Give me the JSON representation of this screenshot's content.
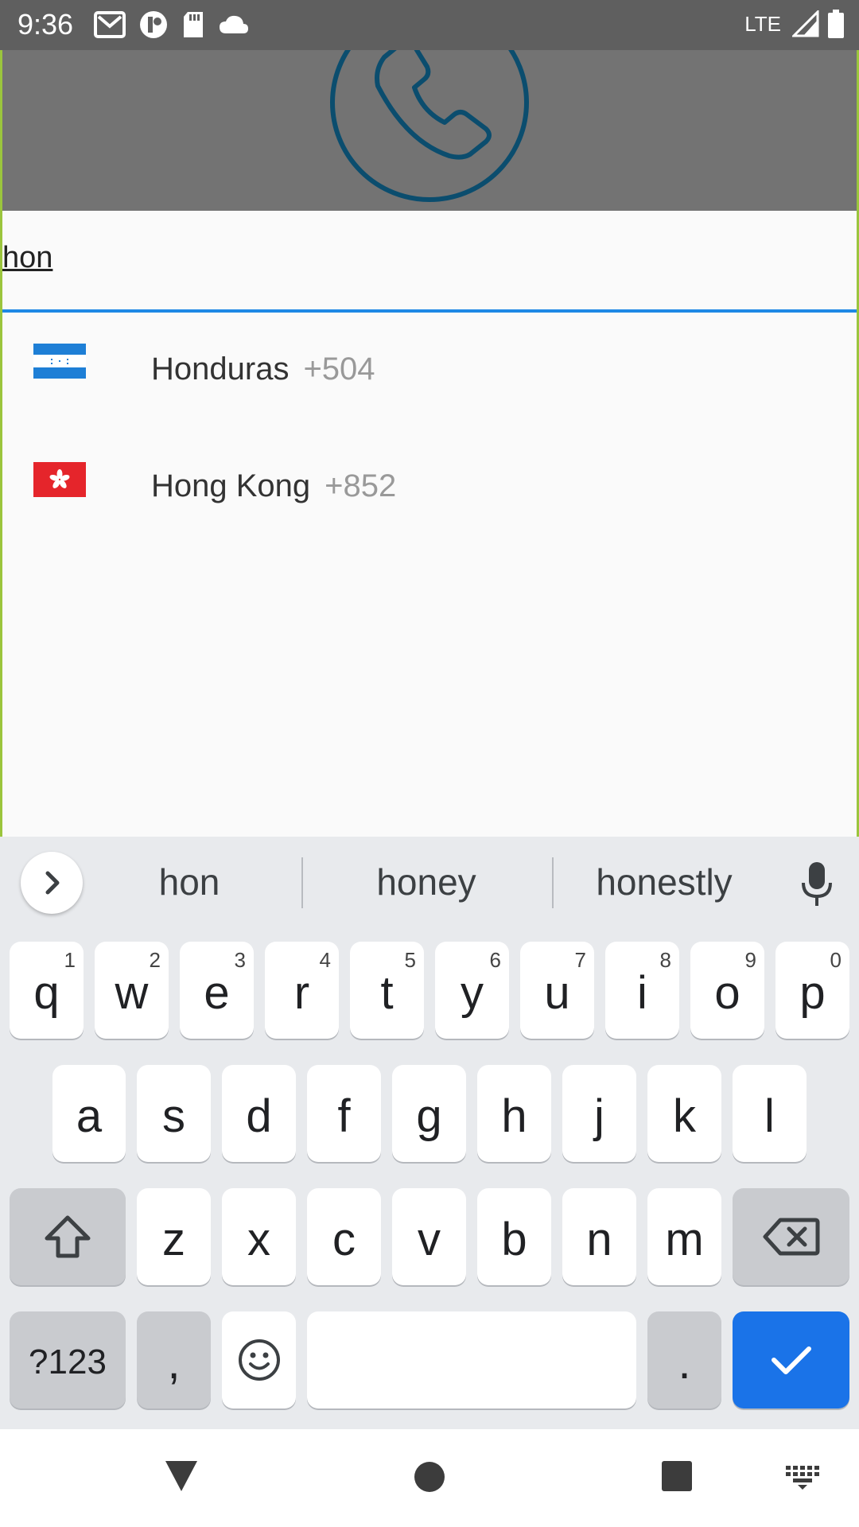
{
  "status_bar": {
    "time": "9:36",
    "network": "LTE",
    "icons_left": [
      "gmail-icon",
      "app-icon",
      "sd-card-icon",
      "cloud-icon"
    ],
    "icons_right": [
      "signal-icon",
      "battery-icon"
    ]
  },
  "header": {
    "logo": "phone-icon",
    "logo_color": "#0b4d6e"
  },
  "search": {
    "value": "hon",
    "underline_color": "#1e88e5"
  },
  "countries": [
    {
      "name": "Honduras",
      "code": "+504",
      "flag": "honduras-flag"
    },
    {
      "name": "Hong Kong",
      "code": "+852",
      "flag": "hong-kong-flag"
    }
  ],
  "keyboard": {
    "suggestions": [
      "hon",
      "honey",
      "honestly"
    ],
    "row1": [
      {
        "key": "q",
        "hint": "1"
      },
      {
        "key": "w",
        "hint": "2"
      },
      {
        "key": "e",
        "hint": "3"
      },
      {
        "key": "r",
        "hint": "4"
      },
      {
        "key": "t",
        "hint": "5"
      },
      {
        "key": "y",
        "hint": "6"
      },
      {
        "key": "u",
        "hint": "7"
      },
      {
        "key": "i",
        "hint": "8"
      },
      {
        "key": "o",
        "hint": "9"
      },
      {
        "key": "p",
        "hint": "0"
      }
    ],
    "row2": [
      "a",
      "s",
      "d",
      "f",
      "g",
      "h",
      "j",
      "k",
      "l"
    ],
    "row3": [
      "z",
      "x",
      "c",
      "v",
      "b",
      "n",
      "m"
    ],
    "symbols_label": "?123",
    "comma_label": ",",
    "period_label": ".",
    "accent_color": "#1a73e8"
  },
  "nav_bar": {
    "icons": [
      "back-icon",
      "home-icon",
      "recents-icon",
      "keyboard-switch-icon"
    ]
  }
}
